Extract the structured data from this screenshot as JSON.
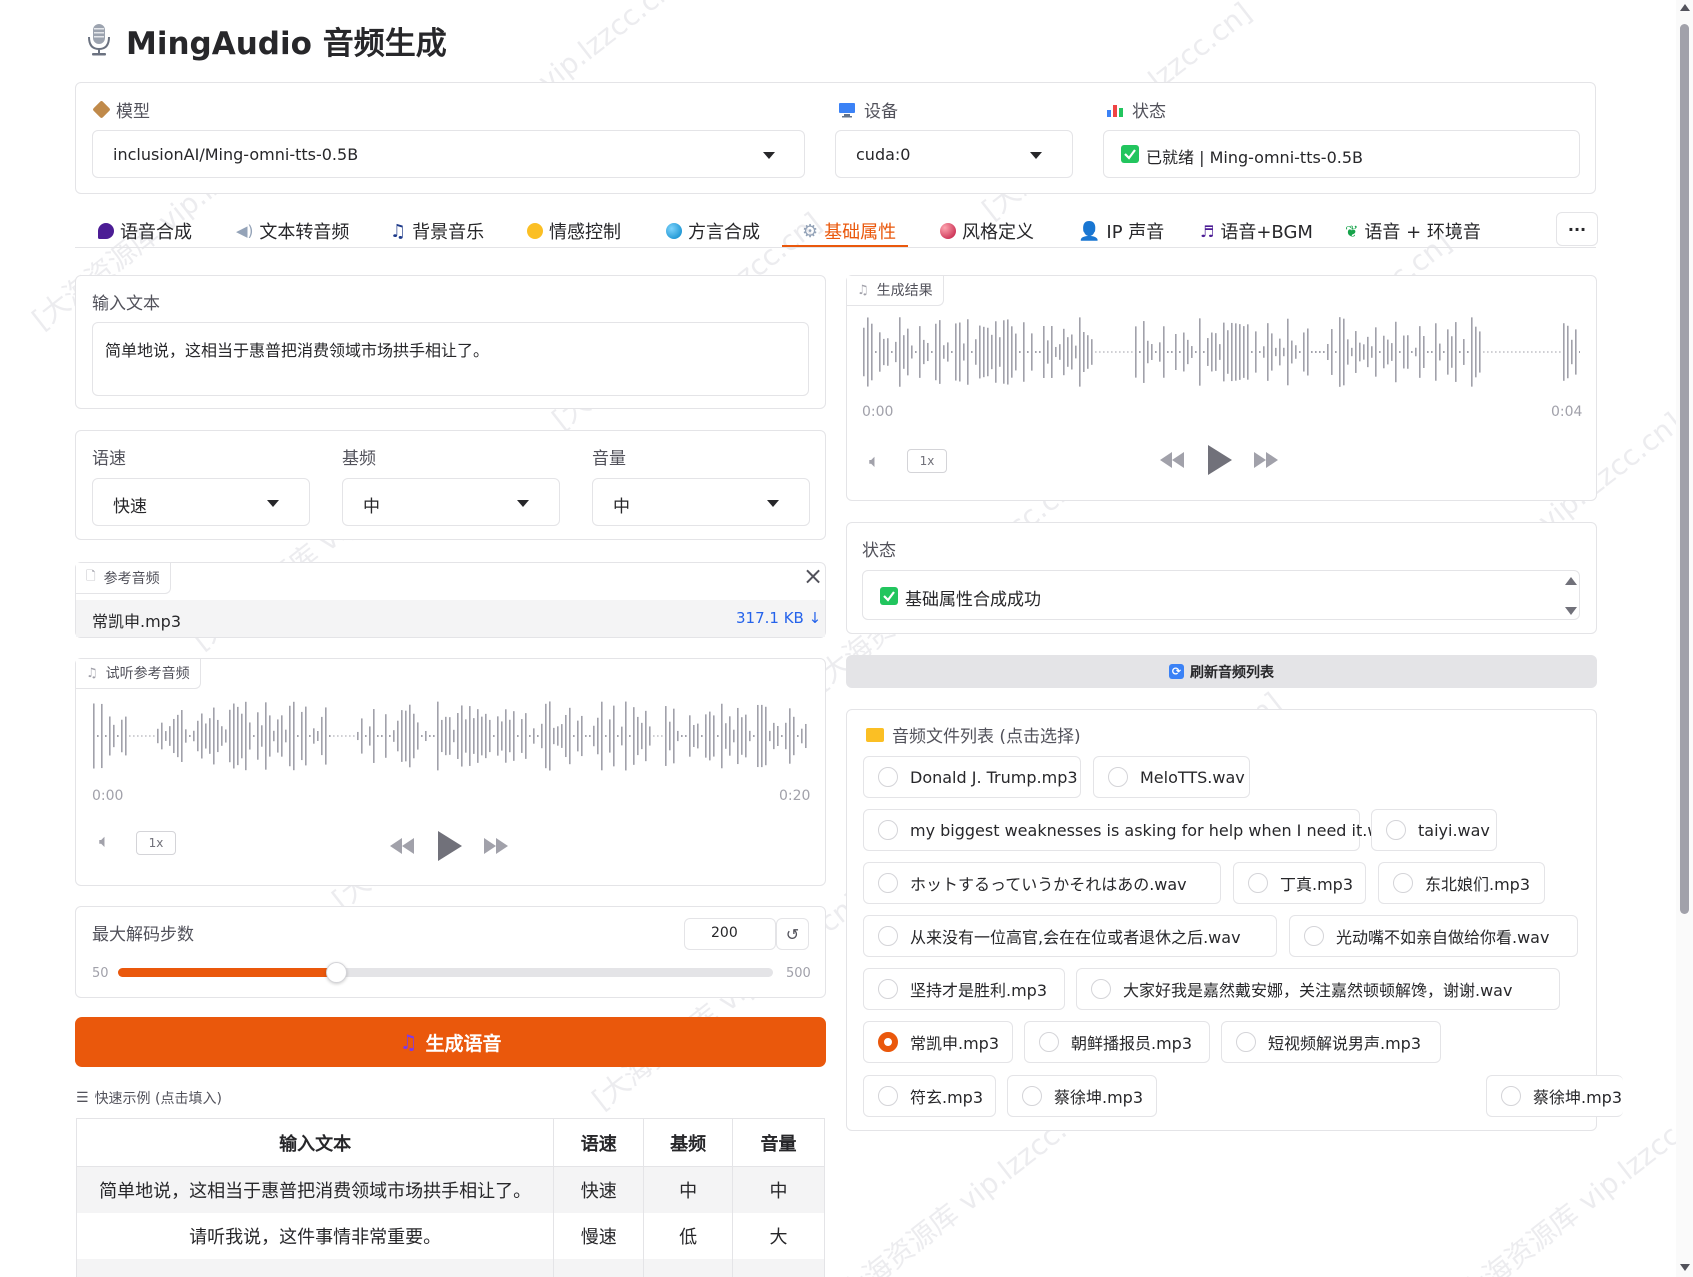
{
  "header": {
    "title": "MingAudio 音频生成"
  },
  "model": {
    "label": "模型",
    "value": "inclusionAI/Ming-omni-tts-0.5B"
  },
  "device": {
    "label": "设备",
    "value": "cuda:0"
  },
  "status_top": {
    "label": "状态",
    "value": "已就绪 | Ming-omni-tts-0.5B"
  },
  "tabs": [
    {
      "label": "语音合成"
    },
    {
      "label": "文本转音频"
    },
    {
      "label": "背景音乐"
    },
    {
      "label": "情感控制"
    },
    {
      "label": "方言合成"
    },
    {
      "label": "基础属性"
    },
    {
      "label": "风格定义"
    },
    {
      "label": "IP 声音"
    },
    {
      "label": "语音+BGM"
    },
    {
      "label": "语音 + 环境音"
    }
  ],
  "tabs_more": "···",
  "input_text": {
    "label": "输入文本",
    "value": "简单地说，这相当于惠普把消费领域市场拱手相让了。"
  },
  "speed": {
    "label": "语速",
    "value": "快速"
  },
  "pitch": {
    "label": "基频",
    "value": "中"
  },
  "volume": {
    "label": "音量",
    "value": "中"
  },
  "ref_audio": {
    "tag": "参考音频",
    "filename": "常凯申.mp3",
    "size": "317.1 KB ↓",
    "close": "×"
  },
  "preview": {
    "tag": "试听参考音频",
    "start": "0:00",
    "end": "0:20",
    "speed": "1x"
  },
  "decode": {
    "label": "最大解码步数",
    "value": "200",
    "min": "50",
    "max": "500",
    "fraction": 0.333,
    "reset": "↺"
  },
  "generate_button": "生成语音",
  "examples": {
    "label": "快速示例 (点击填入)",
    "headers": [
      "输入文本",
      "语速",
      "基频",
      "音量"
    ],
    "rows": [
      [
        "简单地说，这相当于惠普把消费领域市场拱手相让了。",
        "快速",
        "中",
        "中"
      ],
      [
        "请听我说，这件事情非常重要。",
        "慢速",
        "低",
        "大"
      ]
    ]
  },
  "result": {
    "tag": "生成结果",
    "start": "0:00",
    "end": "0:04",
    "speed": "1x"
  },
  "status_result": {
    "label": "状态",
    "value": "基础属性合成成功"
  },
  "refresh_button": "刷新音频列表",
  "audio_list": {
    "label": "音频文件列表 (点击选择)",
    "items": [
      "Donald J. Trump.mp3",
      "MeloTTS.wav",
      "my biggest weaknesses is asking for help when I need it.wav",
      "taiyi.wav",
      "ホットするっていうかそれはあの.wav",
      "丁真.mp3",
      "东北娘们.mp3",
      "从来没有一位高官,会在在位或者退休之后.wav",
      "光动嘴不如亲自做给你看.wav",
      "坚持才是胜利.mp3",
      "大家好我是嘉然戴安娜，关注嘉然顿顿解馋，谢谢.wav",
      "常凯申.mp3",
      "朝鲜播报员.mp3",
      "短视频解说男声.mp3",
      "符玄.mp3",
      "蔡徐坤.mp3",
      "蔡徐坤.mp3"
    ],
    "selected": "常凯申.mp3"
  },
  "colors": {
    "accent": "#ea580c",
    "border": "#e4e4e7",
    "text": "#27272a"
  }
}
